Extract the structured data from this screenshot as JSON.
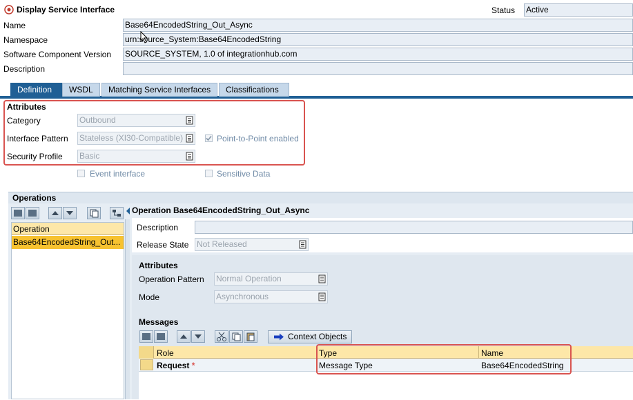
{
  "window": {
    "title": "Display Service Interface"
  },
  "status": {
    "label": "Status",
    "value": "Active"
  },
  "header_fields": [
    {
      "label": "Name",
      "value": "Base64EncodedString_Out_Async"
    },
    {
      "label": "Namespace",
      "value": "urn:source_System:Base64EncodedString"
    },
    {
      "label": "Software Component Version",
      "value": "SOURCE_SYSTEM, 1.0 of integrationhub.com"
    },
    {
      "label": "Description",
      "value": ""
    }
  ],
  "tabs": [
    {
      "label": "Definition",
      "active": true
    },
    {
      "label": "WSDL",
      "active": false
    },
    {
      "label": "Matching Service Interfaces",
      "active": false
    },
    {
      "label": "Classifications",
      "active": false
    }
  ],
  "attributes": {
    "title": "Attributes",
    "category": {
      "label": "Category",
      "value": "Outbound"
    },
    "interface_pattern": {
      "label": "Interface Pattern",
      "value": "Stateless (XI30-Compatible)"
    },
    "security_profile": {
      "label": "Security Profile",
      "value": "Basic"
    },
    "p2p": {
      "label": "Point-to-Point enabled",
      "checked": true
    },
    "event_interface": {
      "label": "Event interface",
      "checked": false
    },
    "sensitive_data": {
      "label": "Sensitive Data",
      "checked": false
    }
  },
  "operations": {
    "title": "Operations",
    "column": "Operation",
    "items": [
      "Base64EncodedString_Out..."
    ],
    "detail_title": "Operation Base64EncodedString_Out_Async",
    "description": {
      "label": "Description",
      "value": ""
    },
    "release_state": {
      "label": "Release State",
      "value": "Not Released"
    },
    "attributes_title": "Attributes",
    "operation_pattern": {
      "label": "Operation Pattern",
      "value": "Normal Operation"
    },
    "mode": {
      "label": "Mode",
      "value": "Asynchronous"
    }
  },
  "messages": {
    "title": "Messages",
    "context_objects": "Context Objects",
    "columns": {
      "role": "Role",
      "type": "Type",
      "name": "Name"
    },
    "rows": [
      {
        "role": "Request",
        "required": "*",
        "type": "Message Type",
        "name": "Base64EncodedString"
      }
    ]
  },
  "colors": {
    "accent": "#1f5f95",
    "highlight": "#d9534f",
    "selected_row": "#f7c230"
  }
}
